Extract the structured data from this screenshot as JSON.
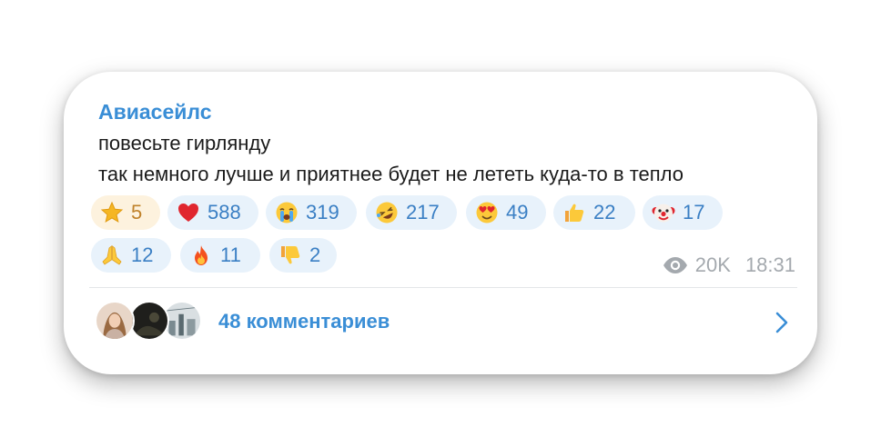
{
  "post": {
    "channel_name": "Авиасейлс",
    "text_lines": [
      "повесьте гирлянду",
      "так немного лучше и приятнее будет не лететь куда-то в тепло"
    ]
  },
  "reactions": [
    {
      "icon": "star-icon",
      "count": "5"
    },
    {
      "icon": "red-heart-icon",
      "count": "588"
    },
    {
      "icon": "loudly-crying-face-icon",
      "count": "319"
    },
    {
      "icon": "rolling-on-floor-laughing-icon",
      "count": "217"
    },
    {
      "icon": "heart-eyes-face-icon",
      "count": "49"
    },
    {
      "icon": "thumbs-up-icon",
      "count": "22"
    },
    {
      "icon": "clown-face-icon",
      "count": "17"
    },
    {
      "icon": "folded-hands-icon",
      "count": "12"
    },
    {
      "icon": "fire-icon",
      "count": "11"
    },
    {
      "icon": "thumbs-down-icon",
      "count": "2"
    }
  ],
  "meta": {
    "views": "20K",
    "time": "18:31"
  },
  "comments": {
    "label": "48 комментариев"
  },
  "colors": {
    "accent": "#3a8ed6",
    "reaction_bg": "#e8f2fb",
    "reaction_active_bg": "#fdf2de",
    "meta_gray": "#a4a9ae"
  }
}
